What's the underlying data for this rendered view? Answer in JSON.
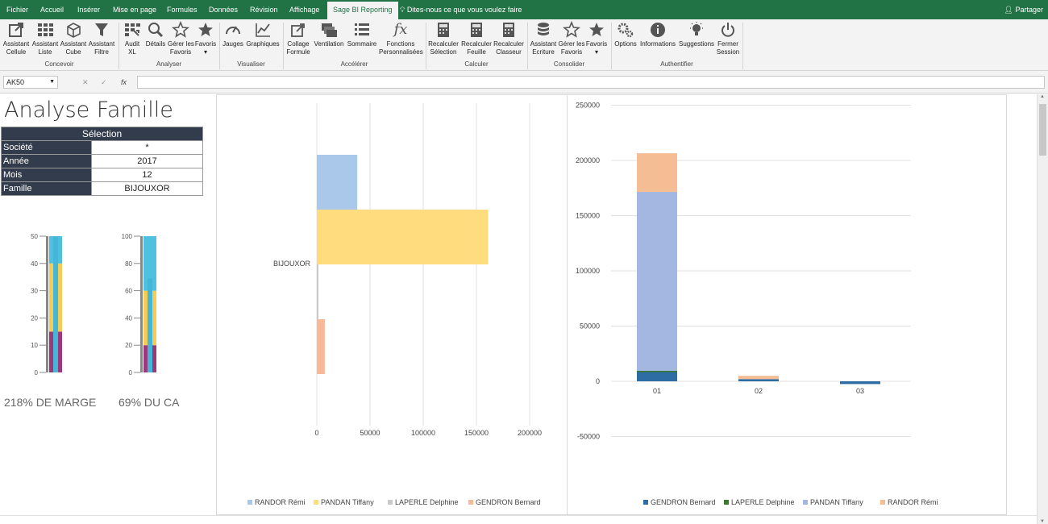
{
  "menu_tabs": [
    "Fichier",
    "Accueil",
    "Insérer",
    "Mise en page",
    "Formules",
    "Données",
    "Révision",
    "Affichage",
    "Sage BI Reporting"
  ],
  "tell_me": "Dites-nous ce que vous voulez faire",
  "share": "Partager",
  "ribbon": {
    "buttons": [
      {
        "label1": "Assistant",
        "label2": "Cellule",
        "icon": "assistant-cell-icon"
      },
      {
        "label1": "Assistant",
        "label2": "Liste",
        "icon": "assistant-list-icon"
      },
      {
        "label1": "Assistant",
        "label2": "Cube",
        "icon": "cube-icon"
      },
      {
        "label1": "Assistant",
        "label2": "Filtre",
        "icon": "filter-icon"
      },
      {
        "label1": "Audit",
        "label2": "XL",
        "icon": "audit-icon"
      },
      {
        "label1": "Détails",
        "label2": "",
        "icon": "details-icon"
      },
      {
        "label1": "Gérer les",
        "label2": "Favoris",
        "icon": "manage-favorites-icon"
      },
      {
        "label1": "Favoris",
        "label2": "▾",
        "icon": "star-icon"
      },
      {
        "label1": "Jauges",
        "label2": "",
        "icon": "gauge-icon"
      },
      {
        "label1": "Graphiques",
        "label2": "",
        "icon": "chart-line-icon"
      },
      {
        "label1": "Collage",
        "label2": "Formule",
        "icon": "paste-formula-icon"
      },
      {
        "label1": "Ventilation",
        "label2": "",
        "icon": "ventilation-icon"
      },
      {
        "label1": "Sommaire",
        "label2": "",
        "icon": "summary-icon"
      },
      {
        "label1": "Fonctions",
        "label2": "Personnalisées",
        "icon": "fx-icon"
      },
      {
        "label1": "Recalculer",
        "label2": "Sélection",
        "icon": "recalc-selection-icon"
      },
      {
        "label1": "Recalculer",
        "label2": "Feuille",
        "icon": "recalc-sheet-icon"
      },
      {
        "label1": "Recalculer",
        "label2": "Classeur",
        "icon": "recalc-workbook-icon"
      },
      {
        "label1": "Assistant",
        "label2": "Ecriture",
        "icon": "database-icon"
      },
      {
        "label1": "Gérer les",
        "label2": "Favoris",
        "icon": "manage-favorites-icon"
      },
      {
        "label1": "Favoris",
        "label2": "▾",
        "icon": "star-icon"
      },
      {
        "label1": "Options",
        "label2": "",
        "icon": "gears-icon"
      },
      {
        "label1": "Informations",
        "label2": "",
        "icon": "info-icon"
      },
      {
        "label1": "Suggestions",
        "label2": "",
        "icon": "lightbulb-icon"
      },
      {
        "label1": "Fermer",
        "label2": "Session",
        "icon": "power-icon"
      }
    ],
    "groups": [
      "Concevoir",
      "Analyser",
      "Visualiser",
      "Accélérer",
      "Calculer",
      "Consolider",
      "Authentifier"
    ]
  },
  "formula_bar": {
    "name_box": "AK50",
    "fx": "fx",
    "cancel": "✕",
    "confirm": "✓",
    "value": ""
  },
  "sheet": {
    "title": "Analyse Famille",
    "selection_header": "Sélection",
    "rows": [
      {
        "label": "Société",
        "value": "*"
      },
      {
        "label": "Année",
        "value": "2017"
      },
      {
        "label": "Mois",
        "value": "12"
      },
      {
        "label": "Famille",
        "value": "BIJOUXOR"
      }
    ],
    "margin_label": "218% DE MARGE",
    "ca_label": "69% DU CA"
  },
  "colors": {
    "green": "#217346",
    "dark": "#333c4d",
    "randor": "#a9c8ea",
    "pandan": "#ffdd7f",
    "laperle": "#c9c9c9",
    "gendron": "#f7b998",
    "gendron_dark": "#2e6ca4",
    "laperle_green": "#3a7a2a",
    "pandan_blue": "#a3b7e1",
    "randor_peach": "#f5bd94"
  },
  "chart_data": [
    {
      "type": "bar",
      "categories": [
        "50%",
        "100%"
      ],
      "series": [
        {
          "name": "",
          "values": [
            15,
            20
          ]
        },
        {
          "name": "",
          "values": [
            25,
            40
          ]
        },
        {
          "name": "",
          "values": [
            10,
            40
          ]
        },
        {
          "name": "",
          "values": [
            50,
            69
          ]
        }
      ],
      "yticks_1": [
        0,
        10,
        20,
        30,
        40,
        50
      ],
      "yticks_2": [
        0,
        20,
        40,
        60,
        80,
        100
      ]
    },
    {
      "type": "bar",
      "orientation": "horizontal",
      "categories": [
        "BIJOUXOR"
      ],
      "series": [
        {
          "name": "RANDOR   Rémi",
          "values": [
            38000
          ]
        },
        {
          "name": "PANDAN   Tiffany",
          "values": [
            161000
          ]
        },
        {
          "name": "LAPERLE   Delphine",
          "values": [
            1500
          ]
        },
        {
          "name": "GENDRON   Bernard",
          "values": [
            7500
          ]
        }
      ],
      "xlim": [
        0,
        200000
      ],
      "xticks": [
        0,
        50000,
        100000,
        150000,
        200000
      ]
    },
    {
      "type": "bar",
      "stacked": true,
      "categories": [
        "01",
        "02",
        "03"
      ],
      "series": [
        {
          "name": "GENDRON   Bernard",
          "values": [
            9000,
            2000,
            -2500
          ]
        },
        {
          "name": "LAPERLE   Delphine",
          "values": [
            500,
            0,
            0
          ]
        },
        {
          "name": "PANDAN   Tiffany",
          "values": [
            162000,
            0,
            0
          ]
        },
        {
          "name": "RANDOR   Rémi",
          "values": [
            35000,
            3000,
            0
          ]
        }
      ],
      "ylim": [
        -50000,
        250000
      ],
      "yticks": [
        -50000,
        0,
        50000,
        100000,
        150000,
        200000,
        250000
      ]
    }
  ]
}
